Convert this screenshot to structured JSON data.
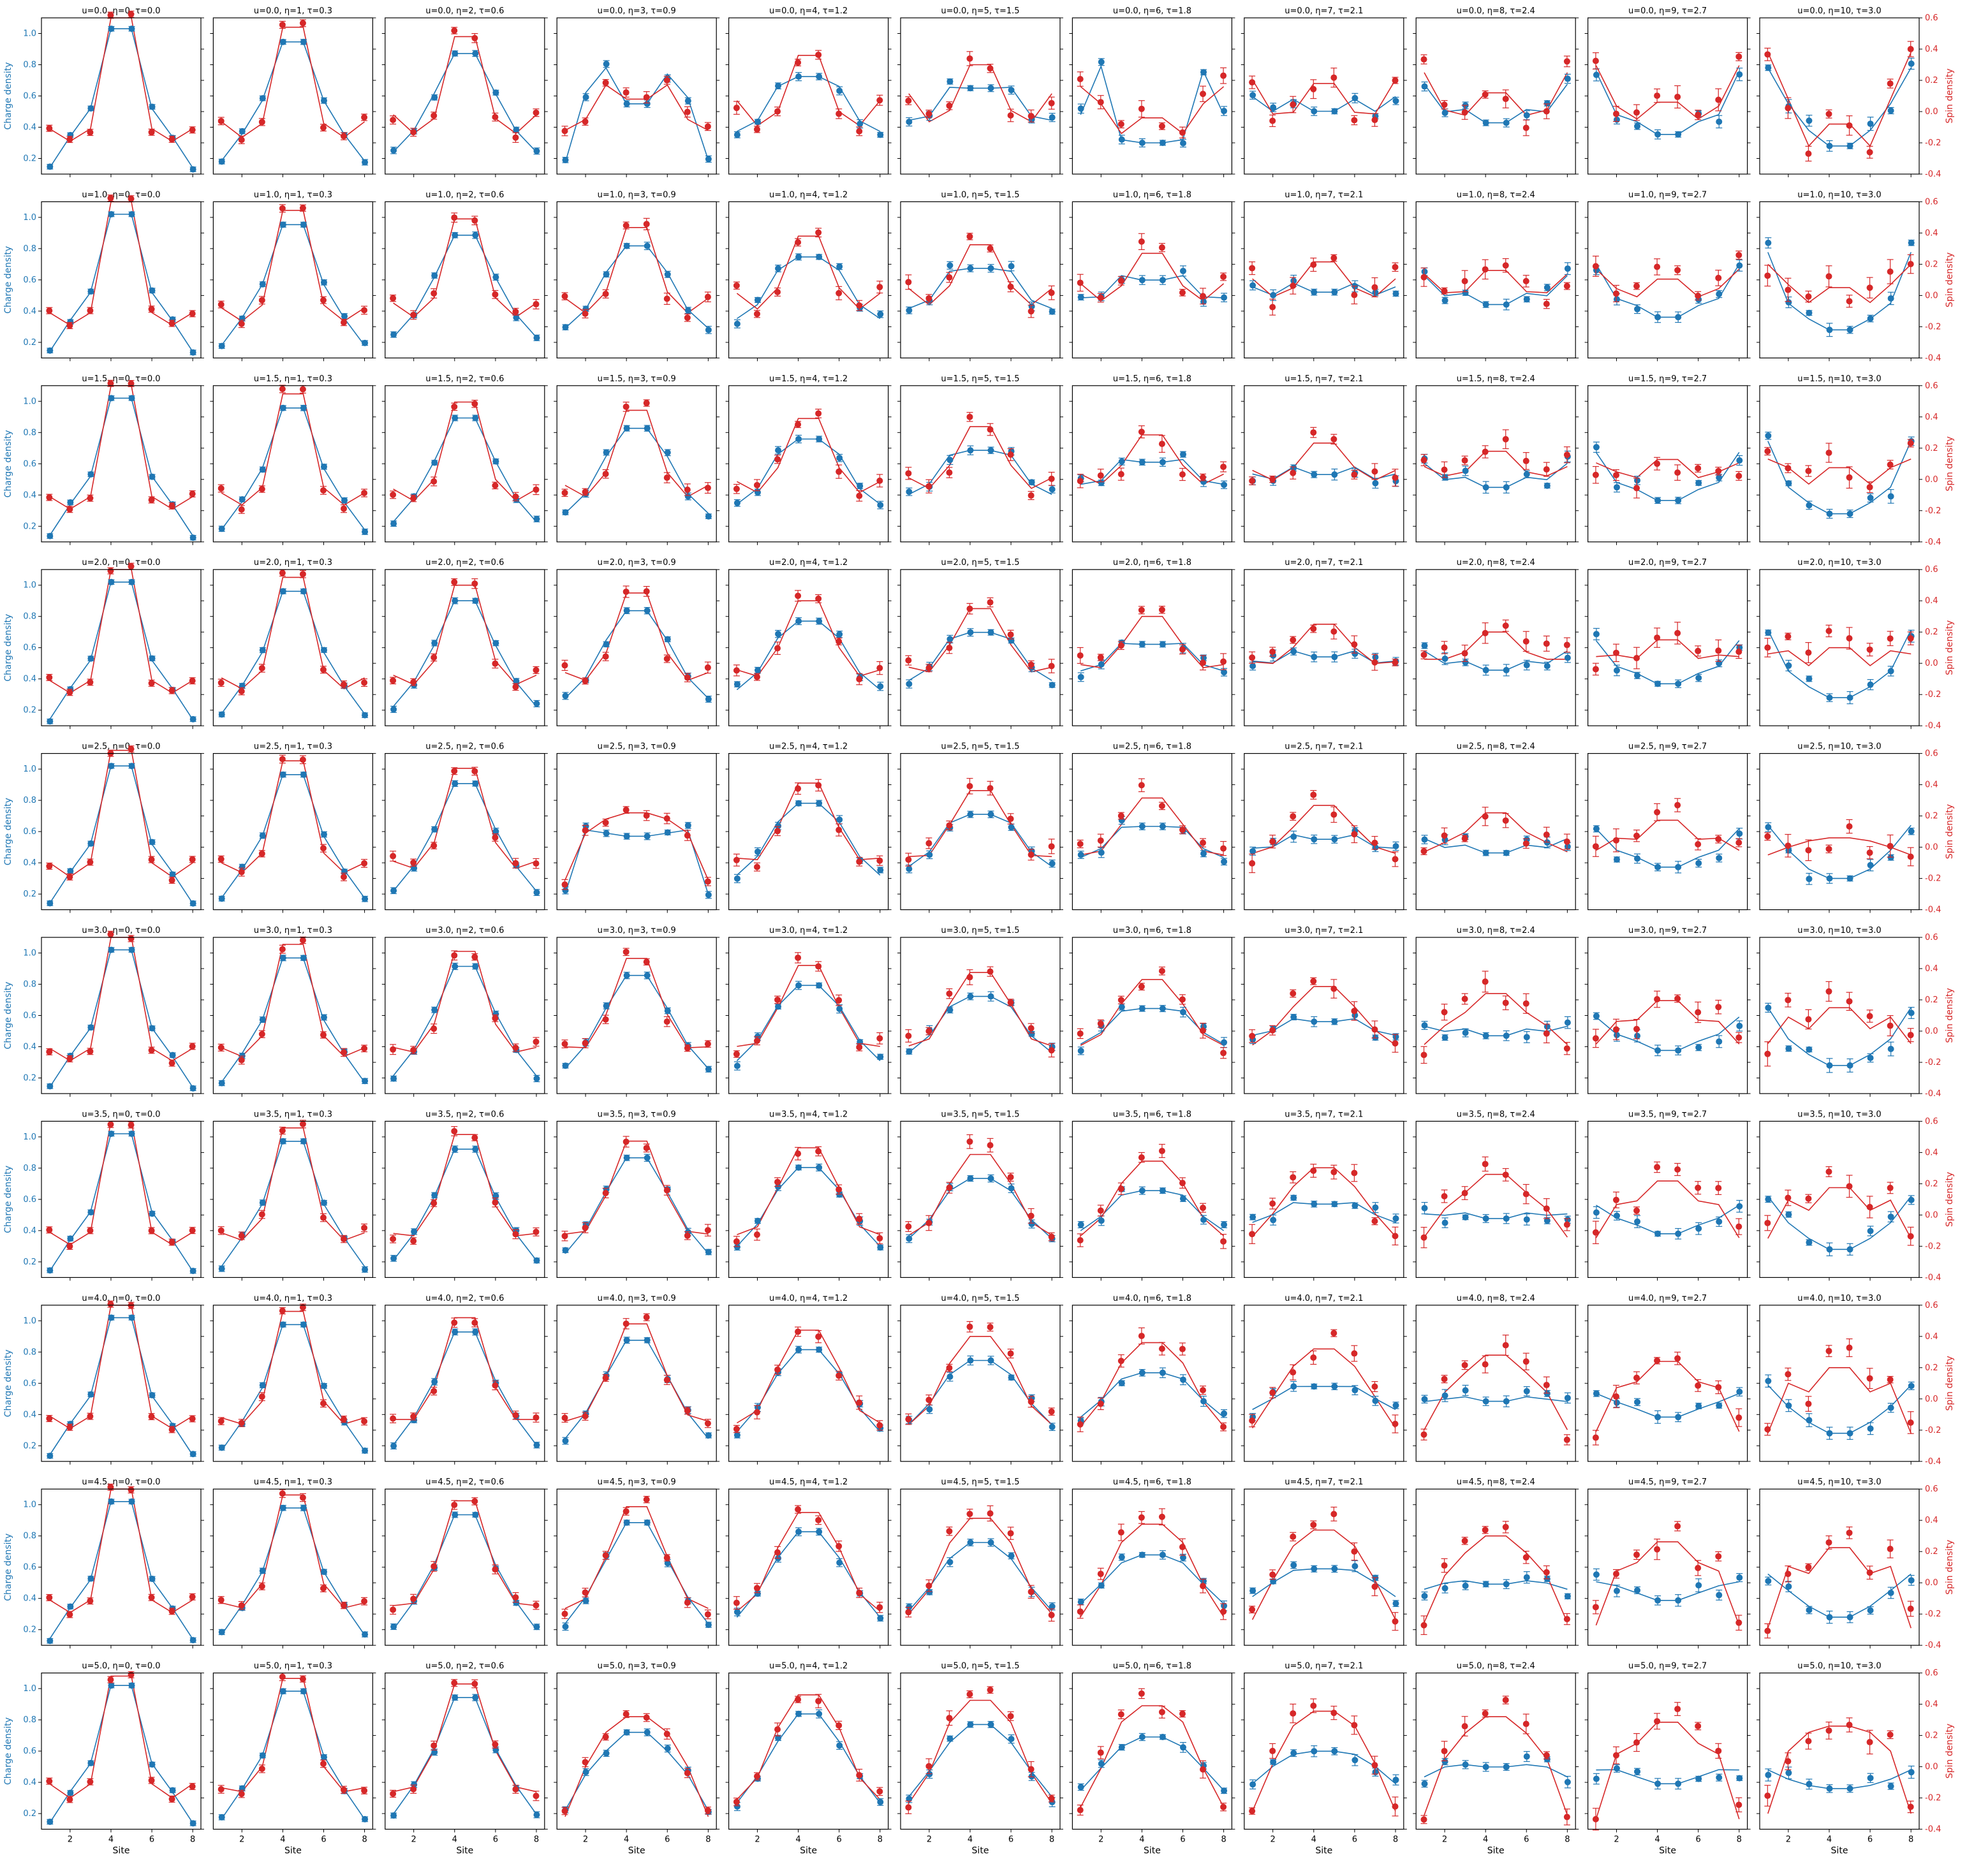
{
  "figure": {
    "u_values": [
      0.0,
      1.0,
      1.5,
      2.0,
      2.5,
      3.0,
      3.5,
      4.0,
      4.5,
      5.0
    ],
    "eta_values": [
      0,
      1,
      2,
      3,
      4,
      5,
      6,
      7,
      8,
      9,
      10
    ],
    "tau_values": [
      0.0,
      0.3,
      0.6,
      0.9,
      1.2,
      1.5,
      1.8,
      2.1,
      2.4,
      2.7,
      3.0
    ],
    "title_template": "u={u}, η={eta}, τ={tau}",
    "xlabel": "Site",
    "ylabel_left": "Charge density",
    "ylabel_right": "Spin density",
    "colors": {
      "charge": "#1f77b4",
      "spin": "#d62728"
    }
  },
  "chart_data": {
    "type": "line",
    "layout": "grid 10 rows (u) x 11 columns (eta)",
    "x": [
      1,
      2,
      3,
      4,
      5,
      6,
      7,
      8
    ],
    "x_ticks": [
      2,
      4,
      6,
      8
    ],
    "xlim": [
      0.6,
      8.4
    ],
    "left_axis": {
      "label": "Charge density",
      "ylim": [
        0.1,
        1.1
      ],
      "ticks": [
        0.2,
        0.4,
        0.6,
        0.8,
        1.0
      ]
    },
    "right_axis": {
      "label": "Spin density",
      "ylim": [
        -0.4,
        0.6
      ],
      "ticks": [
        -0.4,
        -0.2,
        0.0,
        0.2,
        0.4,
        0.6
      ]
    },
    "series_style": {
      "charge": "blue line (model) with blue circle markers and error bars (measured), left axis",
      "spin": "red line (model) with red circle markers and error bars (measured), right axis"
    },
    "panels": [
      {
        "u": 0.0,
        "eta": 0,
        "tau": 0.0,
        "charge": [
          0.14,
          0.34,
          0.52,
          1.03,
          1.03,
          0.52,
          0.34,
          0.14
        ],
        "spin": [
          -0.11,
          -0.19,
          -0.11,
          0.6,
          0.6,
          -0.11,
          -0.19,
          -0.11
        ]
      },
      {
        "u": 0.0,
        "eta": 3,
        "tau": 0.9,
        "charge": [
          0.17,
          0.62,
          0.78,
          0.55,
          0.55,
          0.74,
          0.59,
          0.19
        ],
        "spin": [
          -0.12,
          -0.05,
          0.17,
          0.08,
          0.08,
          0.17,
          -0.05,
          -0.12
        ]
      },
      {
        "u": 0.0,
        "eta": 6,
        "tau": 1.8,
        "charge": [
          0.48,
          0.79,
          0.32,
          0.3,
          0.3,
          0.32,
          0.76,
          0.48
        ],
        "spin": [
          0.16,
          0.05,
          -0.14,
          -0.04,
          -0.04,
          -0.14,
          0.05,
          0.16
        ]
      },
      {
        "u": 0.0,
        "eta": 10,
        "tau": 3.0,
        "charge": [
          0.78,
          0.55,
          0.38,
          0.28,
          0.28,
          0.38,
          0.55,
          0.78
        ],
        "spin": [
          0.38,
          0.08,
          -0.22,
          -0.08,
          -0.08,
          -0.22,
          0.08,
          0.38
        ]
      },
      {
        "u": 2.5,
        "eta": 0,
        "tau": 0.0,
        "charge": [
          0.14,
          0.34,
          0.52,
          1.02,
          1.02,
          0.52,
          0.34,
          0.14
        ],
        "spin": [
          -0.1,
          -0.19,
          -0.1,
          0.62,
          0.62,
          -0.1,
          -0.19,
          -0.1
        ]
      },
      {
        "u": 2.5,
        "eta": 3,
        "tau": 0.9,
        "charge": [
          0.2,
          0.61,
          0.59,
          0.57,
          0.57,
          0.59,
          0.61,
          0.2
        ],
        "spin": [
          -0.21,
          0.09,
          0.18,
          0.22,
          0.22,
          0.18,
          0.09,
          -0.21
        ]
      },
      {
        "u": 2.5,
        "eta": 10,
        "tau": 3.0,
        "charge": [
          0.64,
          0.48,
          0.36,
          0.3,
          0.3,
          0.36,
          0.48,
          0.64
        ],
        "spin": [
          -0.05,
          0.0,
          0.04,
          0.06,
          0.06,
          0.04,
          0.0,
          -0.05
        ]
      },
      {
        "u": 5.0,
        "eta": 0,
        "tau": 0.0,
        "charge": [
          0.14,
          0.34,
          0.52,
          1.02,
          1.02,
          0.52,
          0.34,
          0.14
        ],
        "spin": [
          -0.11,
          -0.2,
          -0.11,
          0.58,
          0.58,
          -0.11,
          -0.2,
          -0.11
        ]
      },
      {
        "u": 5.0,
        "eta": 3,
        "tau": 0.9,
        "charge": [
          0.22,
          0.45,
          0.6,
          0.72,
          0.72,
          0.6,
          0.45,
          0.22
        ],
        "spin": [
          -0.32,
          0.0,
          0.22,
          0.32,
          0.32,
          0.22,
          0.0,
          -0.32
        ]
      },
      {
        "u": 5.0,
        "eta": 10,
        "tau": 3.0,
        "charge": [
          0.48,
          0.42,
          0.38,
          0.36,
          0.36,
          0.38,
          0.42,
          0.48
        ],
        "spin": [
          -0.3,
          0.1,
          0.22,
          0.26,
          0.26,
          0.22,
          0.1,
          -0.3
        ]
      }
    ]
  }
}
